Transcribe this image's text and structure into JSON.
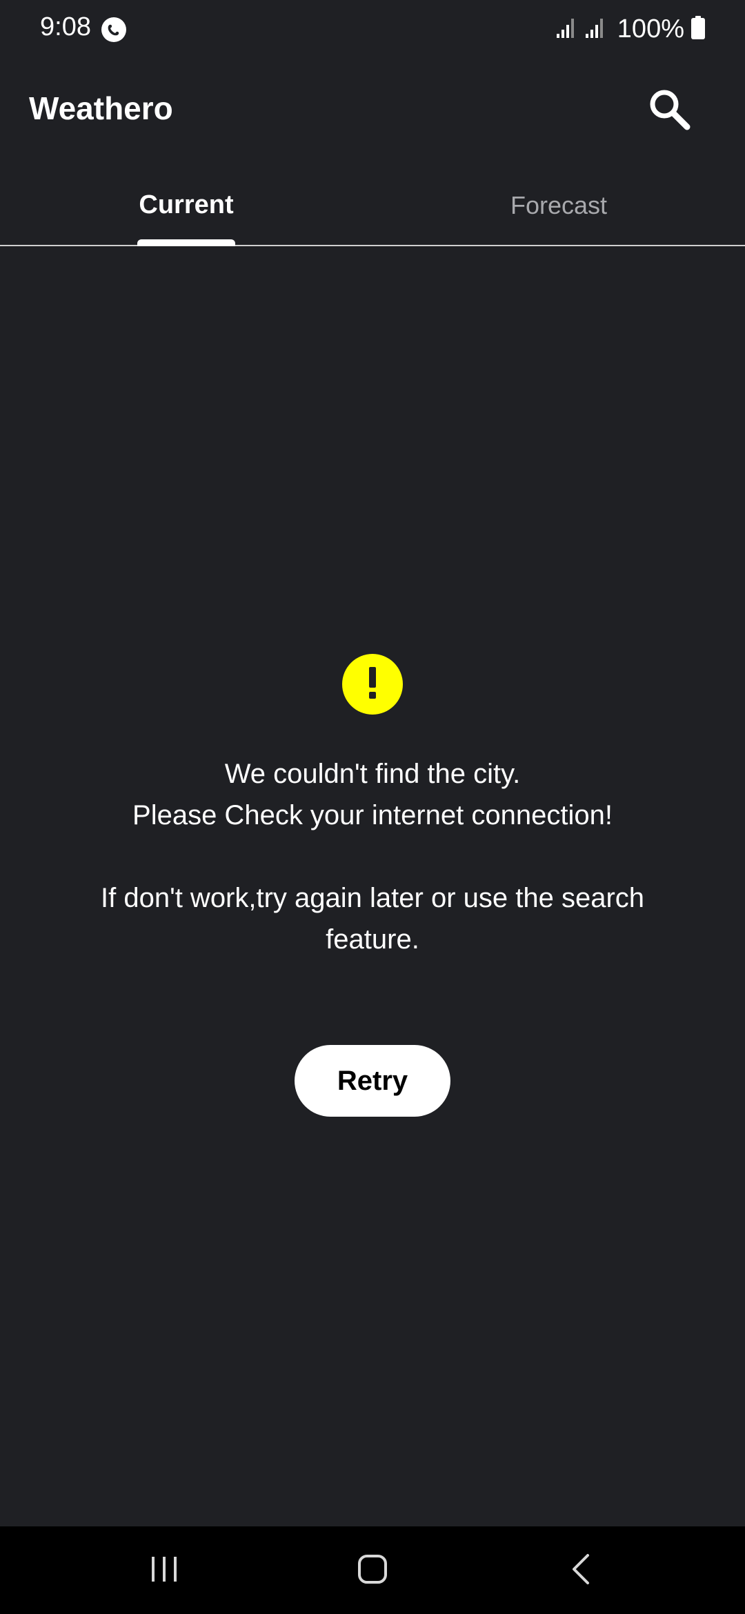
{
  "status_bar": {
    "time": "9:08",
    "battery_percent": "100%",
    "icons": [
      "messenger-icon",
      "signal-icon",
      "signal-icon",
      "battery-icon"
    ]
  },
  "app_bar": {
    "title": "Weathero",
    "search_icon": "search-icon"
  },
  "tabs": [
    {
      "label": "Current",
      "selected": true
    },
    {
      "label": "Forecast",
      "selected": false
    }
  ],
  "error": {
    "icon": "warning-icon",
    "icon_color": "#ffff00",
    "line1": "We couldn't find the city.",
    "line2": "Please Check your internet connection!",
    "line3": "If don't work,try again later or use the search",
    "line4": "feature."
  },
  "retry_label": "Retry",
  "nav_bar": {
    "buttons": [
      "recents-icon",
      "home-icon",
      "back-icon"
    ]
  },
  "colors": {
    "background": "#1f2024",
    "accent": "#ffff00",
    "nav_background": "#000000"
  }
}
